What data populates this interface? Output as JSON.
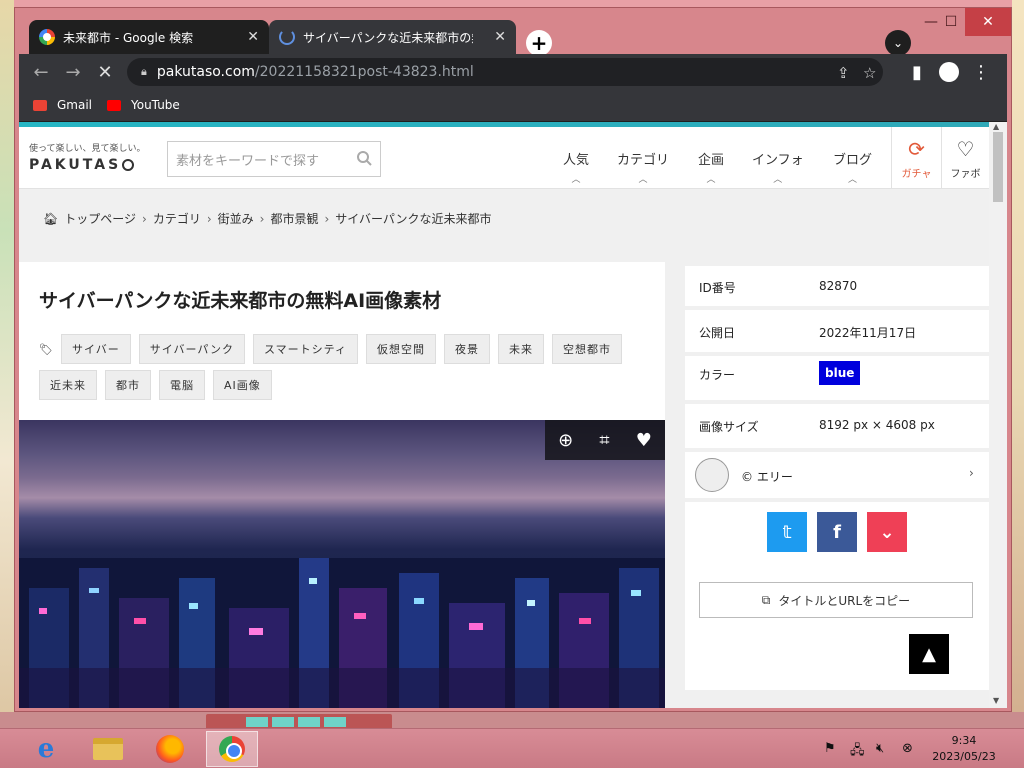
{
  "window_controls": {
    "minimize": "—",
    "maximize": "☐",
    "close": "✕"
  },
  "tabs": [
    {
      "title": "未来都市 - Google 検索",
      "close": "✕"
    },
    {
      "title": "サイバーパンクな近未来都市の無料AI画像素材",
      "close": "✕"
    }
  ],
  "newtab_label": "+",
  "tabsearch_label": "⌄",
  "omnibox": {
    "host": "pakutaso.com",
    "path": "/20221158321post-43823.html"
  },
  "bookmarks": [
    {
      "label": "Gmail",
      "icon": "gmail-icon",
      "color": "#ea4335"
    },
    {
      "label": "YouTube",
      "icon": "youtube-icon",
      "color": "#ff0000"
    }
  ],
  "site": {
    "tagline": "使って楽しい、見て楽しい。",
    "logo": "PAKUTAS",
    "search_placeholder": "素材をキーワードで探す",
    "nav": [
      "人気",
      "カテゴリ",
      "企画",
      "インフォ",
      "ブログ"
    ],
    "gacha_label": "ガチャ",
    "fav_label": "ファボ"
  },
  "breadcrumb": [
    "トップページ",
    "カテゴリ",
    "街並み",
    "都市景観",
    "サイバーパンクな近未来都市"
  ],
  "page_title": "サイバーパンクな近未来都市の無料AI画像素材",
  "tags": [
    "サイバー",
    "サイバーパンク",
    "スマートシティ",
    "仮想空間",
    "夜景",
    "未来",
    "空想都市",
    "近未来",
    "都市",
    "電脳",
    "AI画像"
  ],
  "details": {
    "id_label": "ID番号",
    "id_value": "82870",
    "date_label": "公開日",
    "date_value": "2022年11月17日",
    "color_label": "カラー",
    "color_value": "blue",
    "size_label": "画像サイズ",
    "size_value": "8192 px × 4608 px",
    "author": "© エリー"
  },
  "copy_button": "タイトルとURLをコピー",
  "taskbar": {
    "time": "9:34",
    "date": "2023/05/23"
  },
  "colors": {
    "accent": "#27b6c4",
    "twitter": "#1d9bf0",
    "facebook": "#3b5998",
    "pocket": "#ef4056",
    "color_badge": "#0000dd"
  }
}
